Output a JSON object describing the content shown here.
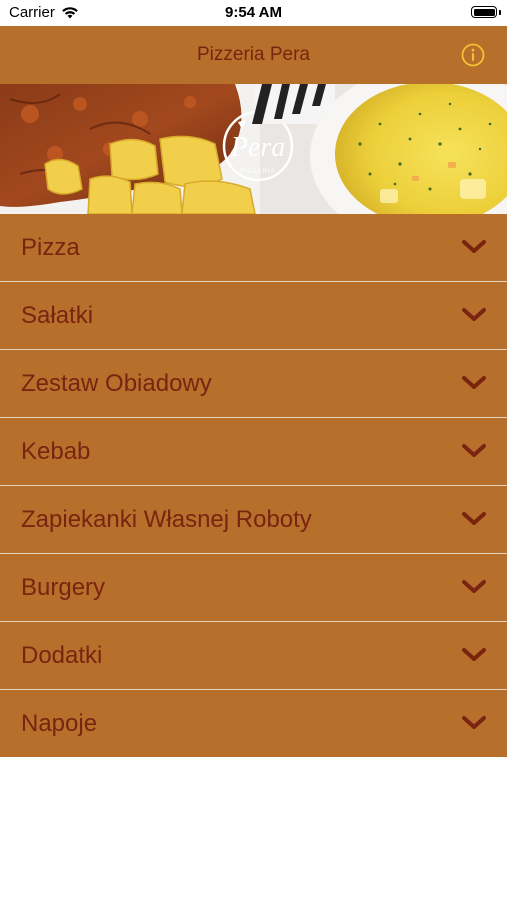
{
  "status_bar": {
    "carrier": "Carrier",
    "time": "9:54 AM"
  },
  "nav": {
    "title": "Pizzeria Pera",
    "info_icon": "info-circle-icon"
  },
  "banner": {
    "logo_text": "Pera",
    "logo_subtext": "PIZZERIA"
  },
  "menu": {
    "items": [
      {
        "label": "Pizza"
      },
      {
        "label": "Sałatki"
      },
      {
        "label": "Zestaw Obiadowy"
      },
      {
        "label": "Kebab"
      },
      {
        "label": "Zapiekanki Własnej Roboty"
      },
      {
        "label": "Burgery"
      },
      {
        "label": "Dodatki"
      },
      {
        "label": "Napoje"
      }
    ]
  },
  "colors": {
    "bar": "#b7702c",
    "text": "#7a2410",
    "accent": "#f2c230",
    "divider": "#e8d2bc"
  }
}
